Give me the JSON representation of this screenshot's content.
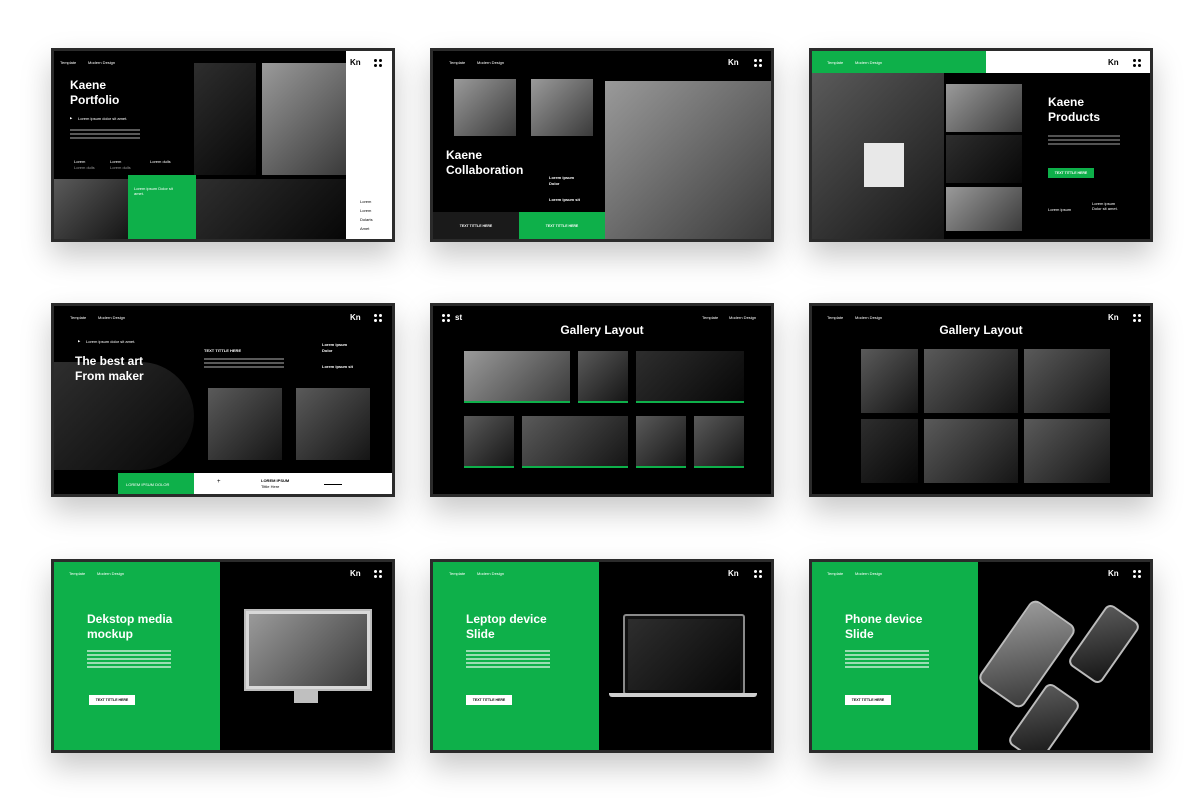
{
  "colors": {
    "accent": "#0eb04a",
    "background": "#000000",
    "page": "#ffffff"
  },
  "common": {
    "template": "Template",
    "modern_design": "Modern Design",
    "logo": "Kn",
    "menu_icon": "four-dots-icon"
  },
  "s1": {
    "title_line1": "Kaene",
    "title_line2": "Portfolio",
    "bullet": "Lorem ipsum dolor sit amet.",
    "col1": "Lorem",
    "col1b": "Lorem dulls",
    "col2": "Lorem",
    "col2b": "Lorem dulls",
    "col3": "Lorem dulls",
    "green_box": "Lorem ipsum Dolor sit amet.",
    "list": [
      "Lorem",
      "Lorem",
      "Dolarts",
      "Amet"
    ]
  },
  "s2": {
    "title_line1": "Kaene",
    "title_line2": "Collaboration",
    "info1": "Lorem ipsum",
    "info2": "Dolor",
    "info3": "Lorem ipsum  sit",
    "btn1": "TEXT TITTLE HERE",
    "btn2": "TEXT TITTLE HERE"
  },
  "s3": {
    "title_line1": "Kaene",
    "title_line2": "Products",
    "btn": "TEXT TITTLE HERE",
    "foot1": "Lorem ipsum",
    "foot2": "Lorem ipsum Dolor sit amet."
  },
  "s4": {
    "bullet": "Lorem ipsum dolor sit amet.",
    "title_line1": "The best art",
    "title_line2": "From maker",
    "label": "TEXT TITTLE HERE",
    "right1": "Lorem ipsum",
    "right2": "Dolor",
    "right3": "Lorem ipsum  sit",
    "green_text": "LOREM IPSUM DOLOR",
    "plus": "+",
    "bottom_title": "LOREM IPSUM",
    "bottom_sub": "Tittle Here"
  },
  "s5": {
    "logo": "st",
    "title": "Gallery Layout"
  },
  "s6": {
    "title": "Gallery Layout"
  },
  "s7": {
    "title_line1": "Dekstop media",
    "title_line2": "mockup",
    "btn": "TEXT TITTLE HERE"
  },
  "s8": {
    "title_line1": "Leptop device",
    "title_line2": "Slide",
    "btn": "TEXT TITTLE HERE"
  },
  "s9": {
    "title_line1": "Phone device",
    "title_line2": "Slide",
    "btn": "TEXT TITTLE HERE"
  }
}
